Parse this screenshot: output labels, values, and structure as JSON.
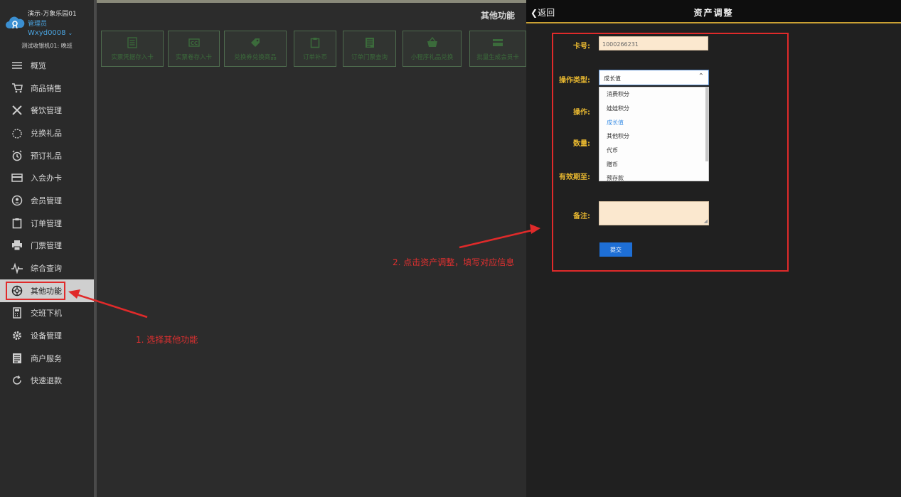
{
  "sidebar": {
    "store_name": "演示-万象乐园01",
    "role": "管理员",
    "username": "Wxyd0008",
    "terminal": "测试收银机01: 晚班",
    "items": [
      {
        "label": "概览",
        "icon": "list-icon"
      },
      {
        "label": "商品销售",
        "icon": "cart-icon"
      },
      {
        "label": "餐饮管理",
        "icon": "utensils-icon"
      },
      {
        "label": "兑换礼品",
        "icon": "gift-icon"
      },
      {
        "label": "预订礼品",
        "icon": "alarm-clock-icon"
      },
      {
        "label": "入会办卡",
        "icon": "card-icon"
      },
      {
        "label": "会员管理",
        "icon": "member-icon"
      },
      {
        "label": "订单管理",
        "icon": "clipboard-icon"
      },
      {
        "label": "门票管理",
        "icon": "printer-icon"
      },
      {
        "label": "综合查询",
        "icon": "pulse-icon"
      },
      {
        "label": "其他功能",
        "icon": "aperture-icon",
        "active": true
      },
      {
        "label": "交班下机",
        "icon": "calculator-icon"
      },
      {
        "label": "设备管理",
        "icon": "gear-icon"
      },
      {
        "label": "商户服务",
        "icon": "document-icon"
      },
      {
        "label": "快速退款",
        "icon": "refresh-icon"
      }
    ]
  },
  "main": {
    "title": "其他功能",
    "tiles": [
      {
        "label": "实票凭据存入卡",
        "icon": "list-icon"
      },
      {
        "label": "实票卷存入卡",
        "icon": "cc-icon"
      },
      {
        "label": "兑换券兑换商品",
        "icon": "tag-icon"
      },
      {
        "label": "订单补币",
        "icon": "clipboard-icon"
      },
      {
        "label": "订单门票查询",
        "icon": "document-icon"
      },
      {
        "label": "小程序礼品兑换",
        "icon": "basket-icon"
      },
      {
        "label": "批量生成会员卡",
        "icon": "card-icon"
      }
    ]
  },
  "panel": {
    "back_label": "返回",
    "title": "资产调整",
    "form": {
      "card_label": "卡号:",
      "card_value": "1000266231",
      "type_label": "操作类型:",
      "type_value": "成长值",
      "op_label": "操作:",
      "qty_label": "数量:",
      "expiry_label": "有效期至:",
      "note_label": "备注:",
      "submit_label": "提交",
      "options": [
        "消费积分",
        "娃娃积分",
        "成长值",
        "其他积分",
        "代币",
        "赠币",
        "预存款"
      ],
      "selected_option": "成长值"
    }
  },
  "annotations": {
    "step1": "1. 选择其他功能",
    "step2": "2. 点击资产调整，填写对应信息"
  },
  "colors": {
    "accent_red": "#e02a2a",
    "label_gold": "#e8b830",
    "submit_blue": "#1e6fd6",
    "link_blue": "#4aa3df"
  }
}
